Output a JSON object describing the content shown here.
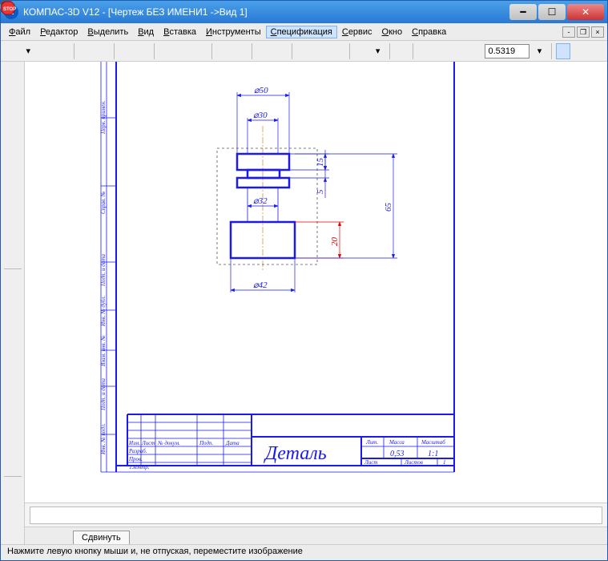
{
  "title": "КОМПАС-3D V12 - [Чертеж БЕЗ ИМЕНИ1 ->Вид 1]",
  "menu": {
    "file": "Файл",
    "editor": "Редактор",
    "select": "Выделить",
    "view": "Вид",
    "insert": "Вставка",
    "tools": "Инструменты",
    "spec": "Спецификация",
    "service": "Сервис",
    "window": "Окно",
    "help": "Справка"
  },
  "toolbar": {
    "zoom_value": "0.5319"
  },
  "drawing": {
    "dims": {
      "d50": "⌀50",
      "d30": "⌀30",
      "d32": "⌀32",
      "d42": "⌀42",
      "h15": "15",
      "h5": "5",
      "h20": "20",
      "h65": "65"
    },
    "title_block": {
      "title": "Деталь",
      "lit": "Лит.",
      "mass": "Масса",
      "scale": "Масштаб",
      "mass_val": "0,53",
      "scale_val": "1:1",
      "sheet": "Лист",
      "sheets": "Листов",
      "sheets_val": "1",
      "row_izm": "Изм.",
      "row_list": "Лист",
      "row_doc": "№ докум.",
      "row_sign": "Подп.",
      "row_date": "Дата",
      "row_razrab": "Разраб.",
      "row_prov": "Пров.",
      "row_tkontr": "Т.контр."
    },
    "side_labels": {
      "a": "Инв. № подл.",
      "b": "Подп. и дата",
      "c": "Взам. инв. №",
      "d": "Инв. № дубл.",
      "e": "Подп. и дата",
      "f": "Справ. №",
      "g": "Перв. примен."
    }
  },
  "tab": {
    "label": "Сдвинуть"
  },
  "status": {
    "text": "Нажмите левую кнопку мыши и, не отпуская, переместите изображение"
  }
}
